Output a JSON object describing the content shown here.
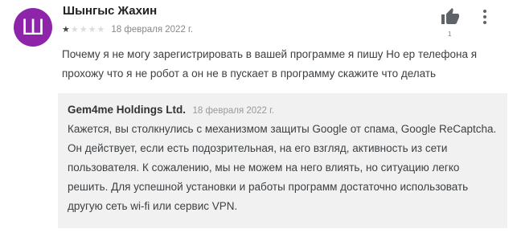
{
  "review": {
    "avatar_letter": "Ш",
    "author": "Шынгыс Жахин",
    "rating": 1,
    "max_rating": 5,
    "date": "18 февраля 2022 г.",
    "likes": "1",
    "text": "Почему я не могу зарегистрировать в вашей программе я пишу Но ер телефона я прохожу что я не робот а он не в пускает в программу скажите что делать"
  },
  "reply": {
    "author": "Gem4me Holdings Ltd.",
    "date": "18 февраля 2022 г.",
    "text": "Кажется, вы столкнулись с механизмом защиты Google от спама, Google ReCaptcha. Он действует, если есть подозрительная, на его взгляд, активность из сети пользователя. К сожалению, мы не можем на него влиять, но ситуацию легко решить. Для успешной установки и работы программ достаточно использовать другую сеть wi-fi или сервис VPN."
  },
  "icons": {
    "thumb": "thumbs-up-icon",
    "menu": "more-vert-icon"
  },
  "colors": {
    "avatar_bg": "#8e24aa",
    "reply_bg": "#f1f1f1",
    "star_filled": "#444444",
    "star_empty": "#dadce0"
  }
}
